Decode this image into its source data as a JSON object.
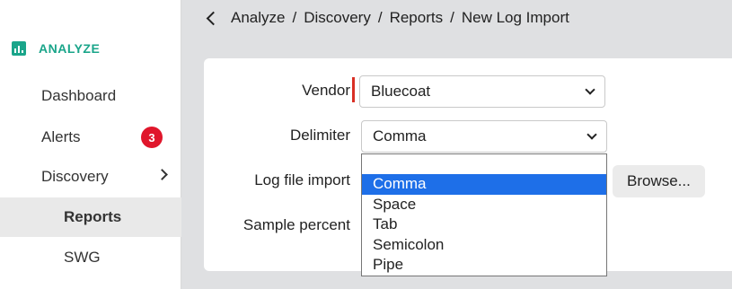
{
  "sidebar": {
    "section": "ANALYZE",
    "items": [
      {
        "label": "Dashboard"
      },
      {
        "label": "Alerts",
        "badge": "3"
      },
      {
        "label": "Discovery"
      },
      {
        "label": "Reports"
      },
      {
        "label": "SWG"
      }
    ]
  },
  "breadcrumb": [
    "Analyze",
    "Discovery",
    "Reports",
    "New Log Import"
  ],
  "breadcrumb_separator": "/",
  "form": {
    "vendor_label": "Vendor",
    "vendor_value": "Bluecoat",
    "delimiter_label": "Delimiter",
    "delimiter_value": "Comma",
    "log_file_label": "Log file import",
    "browse_label": "Browse...",
    "sample_label": "Sample percent"
  },
  "delimiter_options": [
    "Comma",
    "Space",
    "Tab",
    "Semicolon",
    "Pipe"
  ],
  "colors": {
    "accent": "#1aa58a",
    "badge": "#e0162b",
    "selection": "#1e6fe8",
    "required": "#d93025"
  }
}
